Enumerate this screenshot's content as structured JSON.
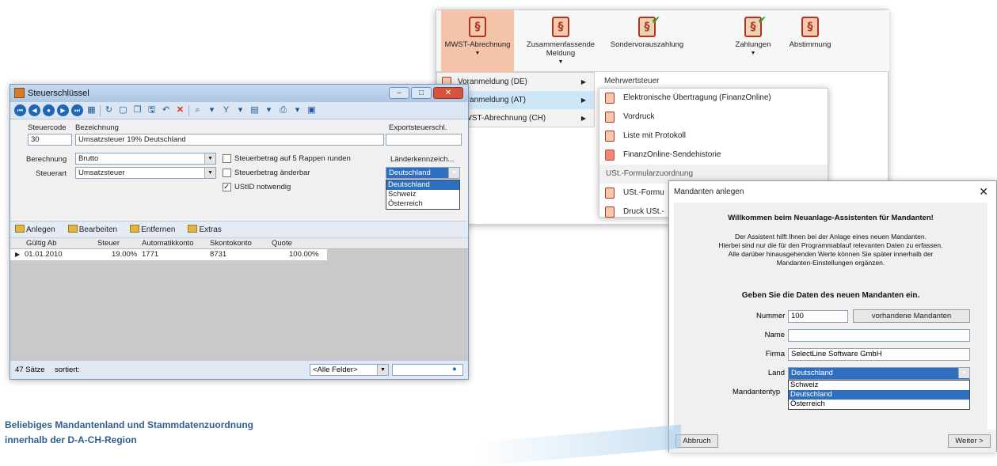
{
  "ribbon": {
    "buttons": [
      {
        "label": "MWST-Abrechnung",
        "has_dropdown": true,
        "active": true
      },
      {
        "label": "Zusammenfassende Meldung",
        "has_dropdown": true
      },
      {
        "label": "Sondervorauszahlung"
      },
      {
        "label": "Zahlungen",
        "has_dropdown": true
      },
      {
        "label": "Abstimmung"
      }
    ],
    "section_label": "Mehrwertsteuer"
  },
  "mwst_menu": {
    "items": [
      {
        "label": "Voranmeldung (DE)"
      },
      {
        "label": "Voranmeldung (AT)"
      },
      {
        "label": "MWST-Abrechnung (CH)"
      }
    ],
    "submenu": {
      "items": [
        "Elektronische Übertragung (FinanzOnline)",
        "Vordruck",
        "Liste mit Protokoll",
        "FinanzOnline-Sendehistorie"
      ],
      "header": "USt.-Formularzuordnung",
      "items2": [
        "USt.-Formu",
        "Druck USt.-"
      ]
    }
  },
  "steuer_window": {
    "title": "Steuerschlüssel",
    "labels": {
      "steuercode": "Steuercode",
      "bezeichnung": "Bezeichnung",
      "exportsteuer": "Exportsteuerschl.",
      "berechnung": "Berechnung",
      "steuerart": "Steuerart",
      "laenderkennz": "Länderkennzeich..."
    },
    "values": {
      "steuercode": "30",
      "bezeichnung": "Umsatzsteuer 19% Deutschland",
      "berechnung": "Brutto",
      "steuerart": "Umsatzsteuer",
      "laenderkennz": "Deutschland"
    },
    "checkboxes": [
      {
        "label": "Steuerbetrag auf 5 Rappen runden",
        "checked": false
      },
      {
        "label": "Steuerbetrag änderbar",
        "checked": false
      },
      {
        "label": "UStID notwendig",
        "checked": true
      }
    ],
    "country_options": [
      "Deutschland",
      "Schweiz",
      "Österreich"
    ],
    "actions": [
      "Anlegen",
      "Bearbeiten",
      "Entfernen",
      "Extras"
    ],
    "table": {
      "columns": [
        "Gültig Ab",
        "Steuer",
        "Automatikkonto",
        "Skontokonto",
        "Quote"
      ],
      "rows": [
        [
          "01.01.2010",
          "19.00%",
          "1771",
          "8731",
          "100.00%"
        ]
      ]
    },
    "status": {
      "count": "47 Sätze",
      "sort": "sortiert:",
      "filter": "<Alle Felder>"
    }
  },
  "mandant_dialog": {
    "title": "Mandanten anlegen",
    "heading": "Willkommen beim Neuanlage-Assistenten für Mandanten!",
    "intro1": "Der Assistent hilft Ihnen bei der Anlage eines neuen Mandanten.",
    "intro2": "Hierbei sind nur die für den Programmablauf relevanten Daten zu erfassen.",
    "intro3": "Alle darüber hinausgehenden Werte können Sie später innerhalb der",
    "intro4": "Mandanten-Einstellungen ergänzen.",
    "subheading": "Geben Sie die Daten des neuen Mandanten ein.",
    "labels": {
      "nummer": "Nummer",
      "name": "Name",
      "firma": "Firma",
      "land": "Land",
      "typ": "Mandantentyp"
    },
    "values": {
      "nummer": "100",
      "name": "",
      "firma": "SelectLine Software GmbH",
      "land": "Deutschland"
    },
    "existing_button": "vorhandene Mandanten",
    "land_options": [
      "Schweiz",
      "Deutschland",
      "Österreich"
    ],
    "cancel": "Abbruch",
    "next": "Weiter >"
  },
  "caption": {
    "line1": "Beliebiges Mandantenland und Stammdatenzuordnung",
    "line2": "innerhalb der D-A-CH-Region"
  },
  "colors": {
    "accent": "#2f6fc0",
    "caption": "#2f5f90",
    "brand_red": "#b3331c"
  }
}
